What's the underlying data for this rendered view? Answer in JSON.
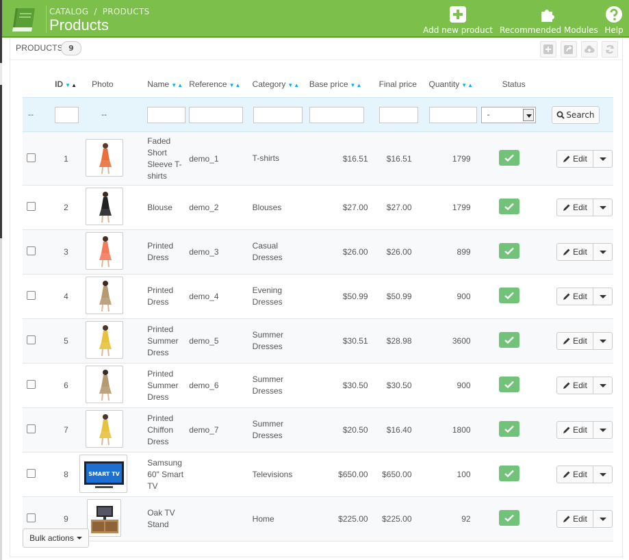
{
  "header": {
    "breadcrumb": [
      "CATALOG",
      "PRODUCTS"
    ],
    "breadcrumb_sep": "/",
    "title": "Products",
    "toolbar": [
      {
        "label": "Add new product",
        "icon": "plus-square-icon"
      },
      {
        "label": "Recommended Modules",
        "icon": "puzzle-icon"
      },
      {
        "label": "Help",
        "icon": "help-icon"
      }
    ]
  },
  "panel": {
    "title": "PRODUCTS",
    "count": "9",
    "actions": [
      "add-icon",
      "export-icon",
      "upload-icon",
      "refresh-icon"
    ]
  },
  "table": {
    "headers": {
      "id": "ID",
      "photo": "Photo",
      "name": "Name",
      "reference": "Reference",
      "category": "Category",
      "base_price": "Base price",
      "final_price": "Final price",
      "quantity": "Quantity",
      "status": "Status"
    },
    "sort_desc": "▼",
    "sort_asc": "▲",
    "filter": {
      "id_placeholder": "--",
      "photo_placeholder": "--",
      "status_value": "-",
      "search_label": "Search"
    },
    "edit_label": "Edit",
    "rows": [
      {
        "id": "1",
        "name": "Faded Short Sleeve T-shirts",
        "reference": "demo_1",
        "category": "T-shirts",
        "base_price": "$16.51",
        "final_price": "$16.51",
        "quantity": "1799",
        "photo": "dress-orange"
      },
      {
        "id": "2",
        "name": "Blouse",
        "reference": "demo_2",
        "category": "Blouses",
        "base_price": "$27.00",
        "final_price": "$27.00",
        "quantity": "1799",
        "photo": "dress-black"
      },
      {
        "id": "3",
        "name": "Printed Dress",
        "reference": "demo_3",
        "category": "Casual Dresses",
        "base_price": "$26.00",
        "final_price": "$26.00",
        "quantity": "899",
        "photo": "dress-coral"
      },
      {
        "id": "4",
        "name": "Printed Dress",
        "reference": "demo_4",
        "category": "Evening Dresses",
        "base_price": "$50.99",
        "final_price": "$50.99",
        "quantity": "900",
        "photo": "dress-pattern"
      },
      {
        "id": "5",
        "name": "Printed Summer Dress",
        "reference": "demo_5",
        "category": "Summer Dresses",
        "base_price": "$30.51",
        "final_price": "$28.98",
        "quantity": "3600",
        "photo": "dress-yellow"
      },
      {
        "id": "6",
        "name": "Printed Summer Dress",
        "reference": "demo_6",
        "category": "Summer Dresses",
        "base_price": "$30.50",
        "final_price": "$30.50",
        "quantity": "900",
        "photo": "dress-pattern"
      },
      {
        "id": "7",
        "name": "Printed Chiffon Dress",
        "reference": "demo_7",
        "category": "Summer Dresses",
        "base_price": "$20.50",
        "final_price": "$16.40",
        "quantity": "1800",
        "photo": "dress-yellow"
      },
      {
        "id": "8",
        "name": "Samsung 60\" Smart TV",
        "reference": "",
        "category": "Televisions",
        "base_price": "$650.00",
        "final_price": "$650.00",
        "quantity": "100",
        "photo": "tv"
      },
      {
        "id": "9",
        "name": "Oak TV Stand",
        "reference": "",
        "category": "Home",
        "base_price": "$225.00",
        "final_price": "$225.00",
        "quantity": "92",
        "photo": "tv-stand"
      }
    ]
  },
  "tv_brand_text": "SMART TV",
  "bulk_actions_label": "Bulk actions",
  "colors": {
    "header_green": "#7cc04b",
    "accent_blue": "#00aff0",
    "status_green": "#72c279",
    "filter_row": "#e6f4fb"
  }
}
